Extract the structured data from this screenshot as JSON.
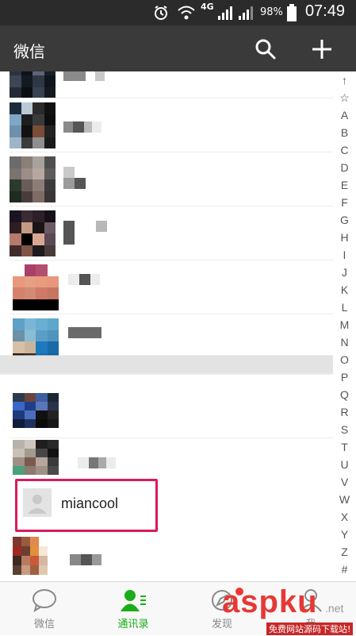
{
  "status_bar": {
    "network": "4G",
    "battery": "98%",
    "time": "07:49"
  },
  "app_bar": {
    "title": "微信",
    "search_icon": "search-icon",
    "add_icon": "plus-icon"
  },
  "index_bar": {
    "letters": [
      "↑",
      "☆",
      "A",
      "B",
      "C",
      "D",
      "E",
      "F",
      "G",
      "H",
      "I",
      "J",
      "K",
      "L",
      "M",
      "N",
      "O",
      "P",
      "Q",
      "R",
      "S",
      "T",
      "U",
      "V",
      "W",
      "X",
      "Y",
      "Z",
      "#"
    ]
  },
  "highlighted_contact": {
    "name": "miancool",
    "border_color": "#d81b60"
  },
  "tabs": [
    {
      "label": "微信",
      "icon": "chat-bubble-icon",
      "active": false
    },
    {
      "label": "通讯录",
      "icon": "contacts-icon",
      "active": true
    },
    {
      "label": "发现",
      "icon": "compass-icon",
      "active": false
    },
    {
      "label": "我",
      "icon": "person-icon",
      "active": false
    }
  ],
  "watermark": {
    "brand": "aspku",
    "domain": ".net",
    "subtitle": "免费网站源码下载站!"
  },
  "colors": {
    "accent": "#1aad19",
    "title_bar": "#3a3a3a",
    "status_bar": "#2b2b2b",
    "badge": "#f43530"
  }
}
